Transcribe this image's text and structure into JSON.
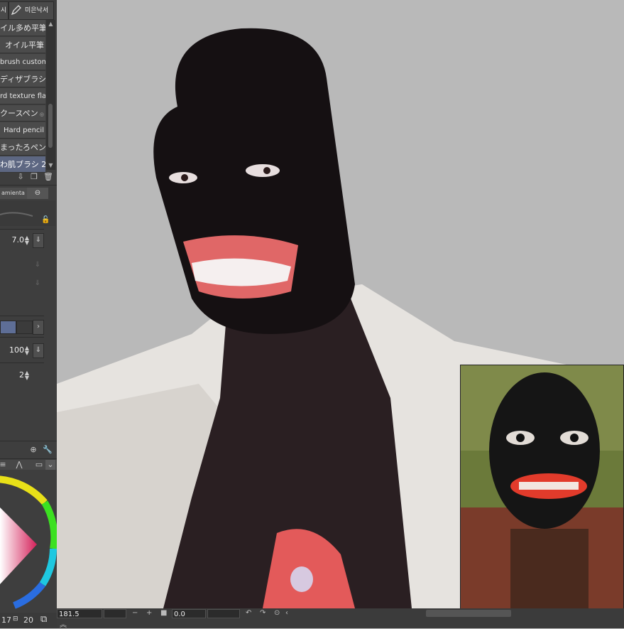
{
  "toolbar": {
    "left_button_label": "시",
    "right_button_label": "미은낙서",
    "pen_icon": "pen-icon"
  },
  "brushes": {
    "items": [
      {
        "label": "イル多め平筆"
      },
      {
        "label": "オイル平筆"
      },
      {
        "label": "brush custom"
      },
      {
        "label": "ディザブラシ"
      },
      {
        "label": "rd texture flat"
      },
      {
        "label": "クースペン"
      },
      {
        "label": "Hard pencil"
      },
      {
        "label": "まったろペン"
      },
      {
        "label": "わ肌ブラシ 2"
      }
    ],
    "selected_index": 8
  },
  "properties": {
    "tab_label": "amienta",
    "brush_size": "7.0",
    "opacity": "100",
    "stabilization": "2",
    "swatch_colors": [
      "#5e6e96",
      "#3b3b3b"
    ]
  },
  "color": {
    "hue_color": "#d4215a"
  },
  "status": {
    "zoom": "181.5",
    "angle": "0.0"
  },
  "bottom": {
    "value_a": "17",
    "value_b": "20"
  },
  "colors": {
    "panel_bg": "#3e3e3e",
    "item_bg": "#4b4b4b",
    "selected": "#5d6782",
    "canvas_bg": "#b9b9b9"
  }
}
